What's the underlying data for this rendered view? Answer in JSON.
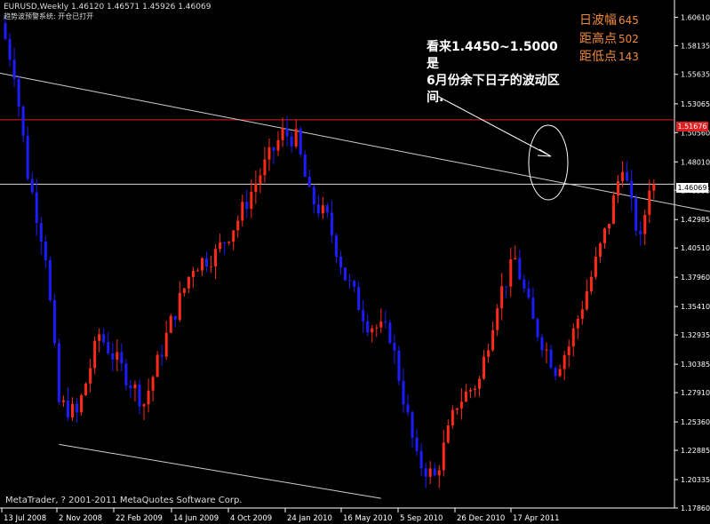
{
  "header": {
    "title": "EURUSD,Weekly  1.46120 1.46571 1.45926 1.46069",
    "indicator": "趋势波预警系统: 开仓已打开"
  },
  "stats": [
    {
      "label": "日波幅",
      "value": "645"
    },
    {
      "label": "距高点",
      "value": "502"
    },
    {
      "label": "距低点",
      "value": "143"
    }
  ],
  "annotation": {
    "line1": "看来1.4450~1.5000是",
    "line2": "6月份余下日子的波动区间."
  },
  "copyright": "MetaTrader, ? 2001-2011 MetaQuotes Software Corp.",
  "price_tags": {
    "red": "1.51676",
    "current": "1.46069"
  },
  "colors": {
    "bull": "#ff2a1a",
    "bear": "#1c1cff",
    "bg": "#000000",
    "grid_text": "#ffffff",
    "red_line": "#e02020"
  },
  "chart_data": {
    "type": "candlestick",
    "symbol": "EURUSD",
    "timeframe": "Weekly",
    "ohlc_last": {
      "open": 1.4612,
      "high": 1.46571,
      "low": 1.45926,
      "close": 1.46069
    },
    "y_ticks": [
      "1.60610",
      "1.58135",
      "1.55635",
      "1.53065",
      "1.50560",
      "1.48010",
      "1.45535",
      "1.42985",
      "1.40510",
      "1.37960",
      "1.35410",
      "1.32935",
      "1.30385",
      "1.27910",
      "1.25360",
      "1.22885",
      "1.20335",
      "1.17860"
    ],
    "ylim": [
      1.1786,
      1.6211
    ],
    "x_ticks": [
      "13 Jul 2008",
      "2 Nov 2008",
      "22 Feb 2009",
      "14 Jun 2009",
      "4 Oct 2009",
      "24 Jan 2010",
      "16 May 2010",
      "5 Sep 2010",
      "26 Dec 2010",
      "17 Apr 2011"
    ],
    "horizontal_lines": [
      {
        "level": 1.51676,
        "color": "red"
      },
      {
        "level": 1.46069,
        "color": "white"
      }
    ],
    "trendlines": [
      {
        "from": {
          "week": 0,
          "price": 1.5565
        },
        "to": {
          "week": 148,
          "price": 1.444
        }
      },
      {
        "from": {
          "week": 12,
          "price": 1.234
        },
        "to": {
          "week": 84,
          "price": 1.187
        }
      }
    ],
    "anchors": [
      {
        "week": 0,
        "price": 1.601
      },
      {
        "week": 3,
        "price": 1.56
      },
      {
        "week": 6,
        "price": 1.47
      },
      {
        "week": 10,
        "price": 1.4
      },
      {
        "week": 13,
        "price": 1.27
      },
      {
        "week": 17,
        "price": 1.26
      },
      {
        "week": 22,
        "price": 1.33
      },
      {
        "week": 27,
        "price": 1.3
      },
      {
        "week": 32,
        "price": 1.27
      },
      {
        "week": 38,
        "price": 1.34
      },
      {
        "week": 43,
        "price": 1.39
      },
      {
        "week": 48,
        "price": 1.4
      },
      {
        "week": 53,
        "price": 1.43
      },
      {
        "week": 58,
        "price": 1.47
      },
      {
        "week": 63,
        "price": 1.505
      },
      {
        "week": 66,
        "price": 1.5
      },
      {
        "week": 69,
        "price": 1.45
      },
      {
        "week": 73,
        "price": 1.43
      },
      {
        "week": 77,
        "price": 1.38
      },
      {
        "week": 82,
        "price": 1.34
      },
      {
        "week": 87,
        "price": 1.33
      },
      {
        "week": 93,
        "price": 1.22
      },
      {
        "week": 97,
        "price": 1.205
      },
      {
        "week": 102,
        "price": 1.27
      },
      {
        "week": 107,
        "price": 1.29
      },
      {
        "week": 111,
        "price": 1.36
      },
      {
        "week": 115,
        "price": 1.395
      },
      {
        "week": 119,
        "price": 1.34
      },
      {
        "week": 124,
        "price": 1.3
      },
      {
        "week": 127,
        "price": 1.32
      },
      {
        "week": 132,
        "price": 1.38
      },
      {
        "week": 136,
        "price": 1.43
      },
      {
        "week": 139,
        "price": 1.48
      },
      {
        "week": 141,
        "price": 1.44
      },
      {
        "week": 143,
        "price": 1.41
      },
      {
        "week": 145,
        "price": 1.461
      }
    ]
  }
}
